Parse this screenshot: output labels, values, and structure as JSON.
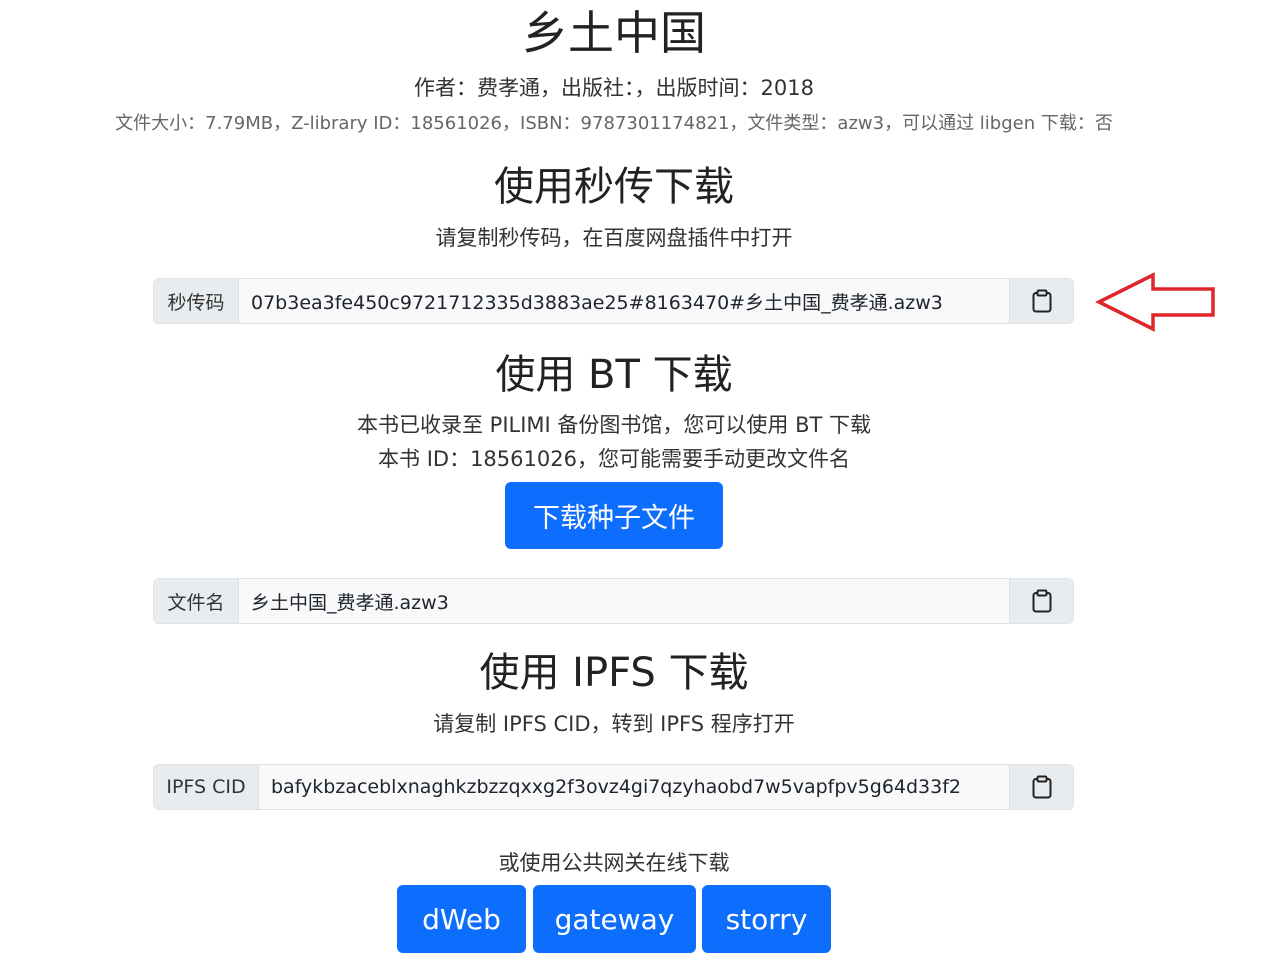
{
  "book": {
    "title": "乡土中国",
    "byline": "作者：费孝通，出版社：，出版时间：2018",
    "meta": "文件大小：7.79MB，Z-library ID：18561026，ISBN：9787301174821，文件类型：azw3，可以通过 libgen 下载：否"
  },
  "rapid": {
    "heading": "使用秒传下载",
    "subtitle": "请复制秒传码，在百度网盘插件中打开",
    "label": "秒传码",
    "value": "07b3ea3fe450c9721712335d3883ae25#8163470#乡土中国_费孝通.azw3"
  },
  "bt": {
    "heading": "使用 BT 下载",
    "line1": "本书已收录至 PILIMI 备份图书馆，您可以使用 BT 下载",
    "line2": "本书 ID：18561026，您可能需要手动更改文件名",
    "button": "下载种子文件",
    "file_label": "文件名",
    "file_value": "乡土中国_费孝通.azw3"
  },
  "ipfs": {
    "heading": "使用 IPFS 下载",
    "subtitle": "请复制 IPFS CID，转到 IPFS 程序打开",
    "label": "IPFS CID",
    "value": "bafykbzaceblxnaghkzbzzqxxg2f3ovz4gi7qzyhaobd7w5vapfpv5g64d33f2",
    "gateway_label": "或使用公共网关在线下载",
    "gateways": [
      "dWeb",
      "gateway",
      "storry"
    ]
  },
  "icons": {
    "copy": "clipboard-icon",
    "annotation": "red-arrow-icon"
  },
  "colors": {
    "primary": "#0d6efd",
    "annotation": "#e0262a"
  }
}
